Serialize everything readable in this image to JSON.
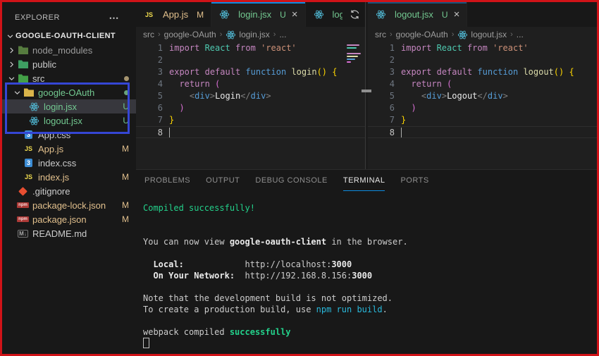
{
  "colors": {
    "accent": "#0d8ce0",
    "annotation_red_border": "#d01318",
    "annotation_blue_box": "#3546d4",
    "git_untracked": "#73c991",
    "git_modified": "#e2c08d",
    "terminal_green": "#23d18b",
    "terminal_cyan": "#29b8db",
    "react_icon": "#53c1de"
  },
  "sidebar": {
    "title": "EXPLORER",
    "more_icon": "ellipsis-horizontal",
    "items": [
      {
        "label": "GOOGLE-OAUTH-CLIENT",
        "kind": "root",
        "depth": 0,
        "expanded": true
      },
      {
        "label": "node_modules",
        "kind": "folder",
        "depth": 1,
        "expanded": false,
        "icon": "folder-node",
        "state": "dim"
      },
      {
        "label": "public",
        "kind": "folder",
        "depth": 1,
        "expanded": false,
        "icon": "folder-public"
      },
      {
        "label": "src",
        "kind": "folder",
        "depth": 1,
        "expanded": true,
        "icon": "folder-src",
        "dot": "#a5946f"
      },
      {
        "label": "google-OAuth",
        "kind": "folder",
        "depth": 2,
        "expanded": true,
        "icon": "folder-default",
        "state": "untracked",
        "dot": "#69a27a"
      },
      {
        "label": "login.jsx",
        "kind": "file",
        "depth": 3,
        "icon": "react",
        "badge": "U",
        "state": "untracked",
        "selected": true
      },
      {
        "label": "logout.jsx",
        "kind": "file",
        "depth": 3,
        "icon": "react",
        "badge": "U",
        "state": "untracked"
      },
      {
        "label": "App.css",
        "kind": "file",
        "depth": 2,
        "icon": "css"
      },
      {
        "label": "App.js",
        "kind": "file",
        "depth": 2,
        "icon": "js",
        "badge": "M",
        "state": "modified"
      },
      {
        "label": "index.css",
        "kind": "file",
        "depth": 2,
        "icon": "css"
      },
      {
        "label": "index.js",
        "kind": "file",
        "depth": 2,
        "icon": "js",
        "badge": "M",
        "state": "modified"
      },
      {
        "label": ".gitignore",
        "kind": "file",
        "depth": 1,
        "icon": "git"
      },
      {
        "label": "package-lock.json",
        "kind": "file",
        "depth": 1,
        "icon": "npm",
        "badge": "M",
        "state": "modified"
      },
      {
        "label": "package.json",
        "kind": "file",
        "depth": 1,
        "icon": "npm",
        "badge": "M",
        "state": "modified"
      },
      {
        "label": "README.md",
        "kind": "file",
        "depth": 1,
        "icon": "md"
      }
    ]
  },
  "editors": [
    {
      "id": "left",
      "tabs": [
        {
          "label": "App.js",
          "icon": "js",
          "badge": "M",
          "state": "modified",
          "active": false,
          "close": false,
          "clipped": false
        },
        {
          "label": "login.jsx",
          "icon": "react",
          "badge": "U",
          "state": "untracked",
          "active": true,
          "close": true,
          "clipped": false
        },
        {
          "label": "logout.jsx",
          "icon": "react",
          "badge": "",
          "state": "untracked",
          "active": false,
          "close": false,
          "clipped": true
        }
      ],
      "actions": [
        "open-changes",
        "split-editor",
        "more-actions"
      ],
      "breadcrumb": [
        {
          "text": "src"
        },
        {
          "text": "google-OAuth"
        },
        {
          "text": "login.jsx",
          "icon": "react"
        },
        {
          "text": "..."
        }
      ],
      "active_line": 8,
      "has_minimap": true,
      "code_lines": [
        [
          {
            "t": "import ",
            "c": "kw"
          },
          {
            "t": "React",
            "c": "cls"
          },
          {
            "t": " ",
            "c": "pl"
          },
          {
            "t": "from",
            "c": "kw"
          },
          {
            "t": " ",
            "c": "pl"
          },
          {
            "t": "'react'",
            "c": "str"
          }
        ],
        [],
        [
          {
            "t": "export",
            "c": "kw"
          },
          {
            "t": " ",
            "c": "pl"
          },
          {
            "t": "default",
            "c": "kw"
          },
          {
            "t": " ",
            "c": "pl"
          },
          {
            "t": "function",
            "c": "blue"
          },
          {
            "t": " ",
            "c": "pl"
          },
          {
            "t": "login",
            "c": "fn"
          },
          {
            "t": "()",
            "c": "b1"
          },
          {
            "t": " ",
            "c": "pl"
          },
          {
            "t": "{",
            "c": "b1"
          }
        ],
        [
          {
            "t": "  ",
            "c": "pl"
          },
          {
            "t": "return",
            "c": "kw"
          },
          {
            "t": " ",
            "c": "pl"
          },
          {
            "t": "(",
            "c": "b2"
          }
        ],
        [
          {
            "t": "    ",
            "c": "pl"
          },
          {
            "t": "<",
            "c": "pun"
          },
          {
            "t": "div",
            "c": "tag"
          },
          {
            "t": ">",
            "c": "pun"
          },
          {
            "t": "Login",
            "c": "txt"
          },
          {
            "t": "</",
            "c": "pun"
          },
          {
            "t": "div",
            "c": "tag"
          },
          {
            "t": ">",
            "c": "pun"
          }
        ],
        [
          {
            "t": "  ",
            "c": "pl"
          },
          {
            "t": ")",
            "c": "b2"
          }
        ],
        [
          {
            "t": "}",
            "c": "b1"
          }
        ],
        []
      ]
    },
    {
      "id": "right",
      "tabs": [
        {
          "label": "logout.jsx",
          "icon": "react",
          "badge": "U",
          "state": "untracked",
          "active": true,
          "close": true,
          "clipped": false,
          "dimTop": true
        }
      ],
      "actions": [],
      "breadcrumb": [
        {
          "text": "src"
        },
        {
          "text": "google-OAuth"
        },
        {
          "text": "logout.jsx",
          "icon": "react"
        },
        {
          "text": "..."
        }
      ],
      "active_line": 8,
      "has_minimap": false,
      "code_lines": [
        [
          {
            "t": "import ",
            "c": "kw"
          },
          {
            "t": "React",
            "c": "cls"
          },
          {
            "t": " ",
            "c": "pl"
          },
          {
            "t": "from",
            "c": "kw"
          },
          {
            "t": " ",
            "c": "pl"
          },
          {
            "t": "'react'",
            "c": "str"
          }
        ],
        [],
        [
          {
            "t": "export",
            "c": "kw"
          },
          {
            "t": " ",
            "c": "pl"
          },
          {
            "t": "default",
            "c": "kw"
          },
          {
            "t": " ",
            "c": "pl"
          },
          {
            "t": "function",
            "c": "blue"
          },
          {
            "t": " ",
            "c": "pl"
          },
          {
            "t": "logout",
            "c": "fn"
          },
          {
            "t": "()",
            "c": "b1"
          },
          {
            "t": " ",
            "c": "pl"
          },
          {
            "t": "{",
            "c": "b1"
          }
        ],
        [
          {
            "t": "  ",
            "c": "pl"
          },
          {
            "t": "return",
            "c": "kw"
          },
          {
            "t": " ",
            "c": "pl"
          },
          {
            "t": "(",
            "c": "b2"
          }
        ],
        [
          {
            "t": "    ",
            "c": "pl"
          },
          {
            "t": "<",
            "c": "pun"
          },
          {
            "t": "div",
            "c": "tag"
          },
          {
            "t": ">",
            "c": "pun"
          },
          {
            "t": "Logout",
            "c": "txt"
          },
          {
            "t": "</",
            "c": "pun"
          },
          {
            "t": "div",
            "c": "tag"
          },
          {
            "t": ">",
            "c": "pun"
          }
        ],
        [
          {
            "t": "  ",
            "c": "pl"
          },
          {
            "t": ")",
            "c": "b2"
          }
        ],
        [
          {
            "t": "}",
            "c": "b1"
          }
        ],
        []
      ]
    }
  ],
  "panel": {
    "tabs": [
      "PROBLEMS",
      "OUTPUT",
      "DEBUG CONSOLE",
      "TERMINAL",
      "PORTS"
    ],
    "active_tab": "TERMINAL",
    "terminal_lines": [
      [
        {
          "t": "Compiled successfully!",
          "c": "green"
        }
      ],
      [],
      [],
      [
        {
          "t": "You can now view "
        },
        {
          "t": "google-oauth-client",
          "c": "b"
        },
        {
          "t": " in the browser."
        }
      ],
      [],
      [
        {
          "t": "  "
        },
        {
          "t": "Local:",
          "c": "b"
        },
        {
          "t": "            http://localhost:"
        },
        {
          "t": "3000",
          "c": "b"
        }
      ],
      [
        {
          "t": "  "
        },
        {
          "t": "On Your Network:",
          "c": "b"
        },
        {
          "t": "  http://192.168.8.156:"
        },
        {
          "t": "3000",
          "c": "b"
        }
      ],
      [],
      [
        {
          "t": "Note that the development build is not optimized."
        }
      ],
      [
        {
          "t": "To create a production build, use "
        },
        {
          "t": "npm run build",
          "c": "cyan"
        },
        {
          "t": "."
        }
      ],
      [],
      [
        {
          "t": "webpack compiled "
        },
        {
          "t": "successfully",
          "c": "gb"
        }
      ],
      [
        {
          "t": "",
          "cursor": true
        }
      ]
    ]
  }
}
